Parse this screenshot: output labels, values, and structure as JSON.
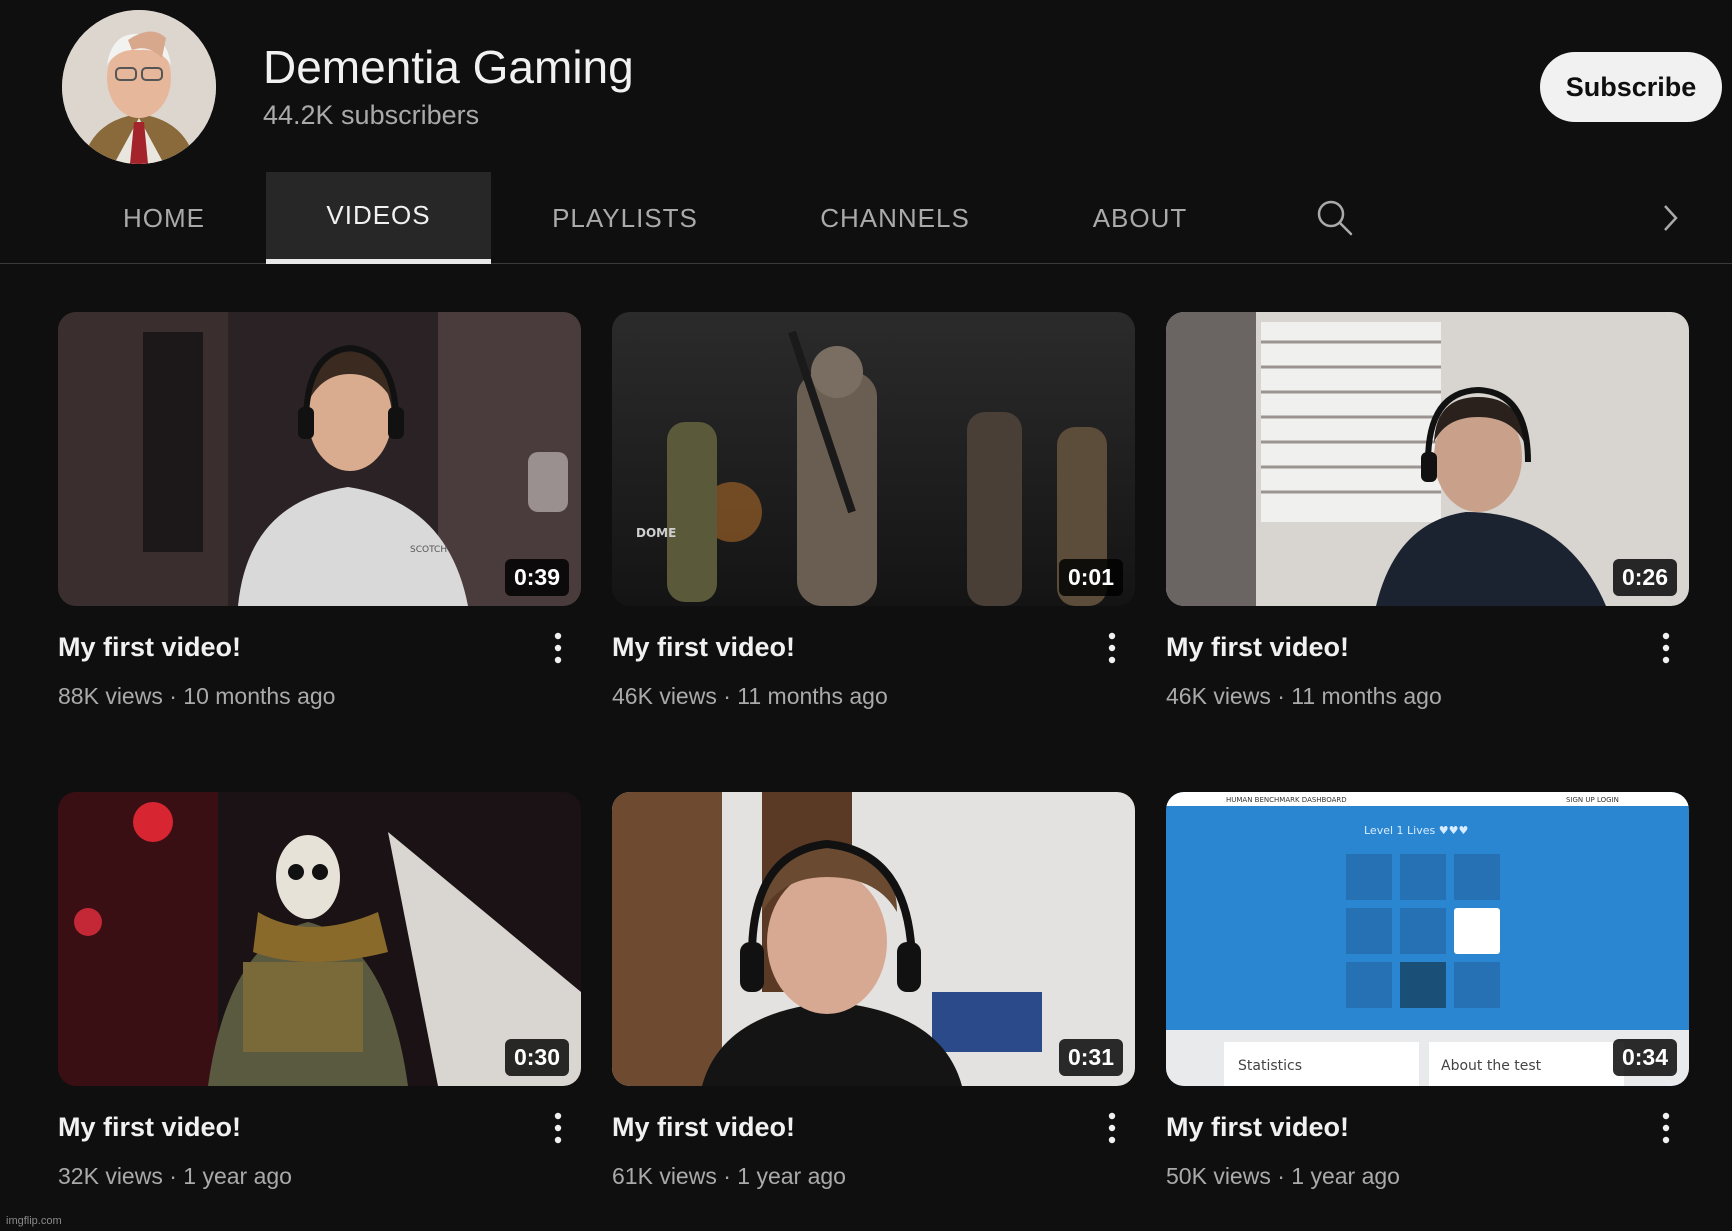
{
  "channel": {
    "name": "Dementia Gaming",
    "subscribers": "44.2K subscribers",
    "subscribe_label": "Subscribe"
  },
  "tabs": [
    {
      "label": "HOME"
    },
    {
      "label": "VIDEOS",
      "active": true
    },
    {
      "label": "PLAYLISTS"
    },
    {
      "label": "CHANNELS"
    },
    {
      "label": "ABOUT"
    }
  ],
  "icons": {
    "search": "search-icon",
    "next": "chevron-right-icon",
    "menu": "more-vert-icon"
  },
  "videos": [
    {
      "title": "My first video!",
      "views": "88K views",
      "age": "10 months ago",
      "duration": "0:39"
    },
    {
      "title": "My first video!",
      "views": "46K views",
      "age": "11 months ago",
      "duration": "0:01"
    },
    {
      "title": "My first video!",
      "views": "46K views",
      "age": "11 months ago",
      "duration": "0:26"
    },
    {
      "title": "My first video!",
      "views": "32K views",
      "age": "1 year ago",
      "duration": "0:30"
    },
    {
      "title": "My first video!",
      "views": "61K views",
      "age": "1 year ago",
      "duration": "0:31"
    },
    {
      "title": "My first video!",
      "views": "50K views",
      "age": "1 year ago",
      "duration": "0:34"
    }
  ],
  "thumb6": {
    "nav_left": "HUMAN BENCHMARK   DASHBOARD",
    "nav_right": "SIGN UP   LOGIN",
    "level": "Level 1   Lives ♥♥♥",
    "stats": "Statistics",
    "about": "About the test"
  },
  "thumb2_text": "DOME",
  "thumb1_shirt": "SCOTCH",
  "watermark": "imgflip.com"
}
